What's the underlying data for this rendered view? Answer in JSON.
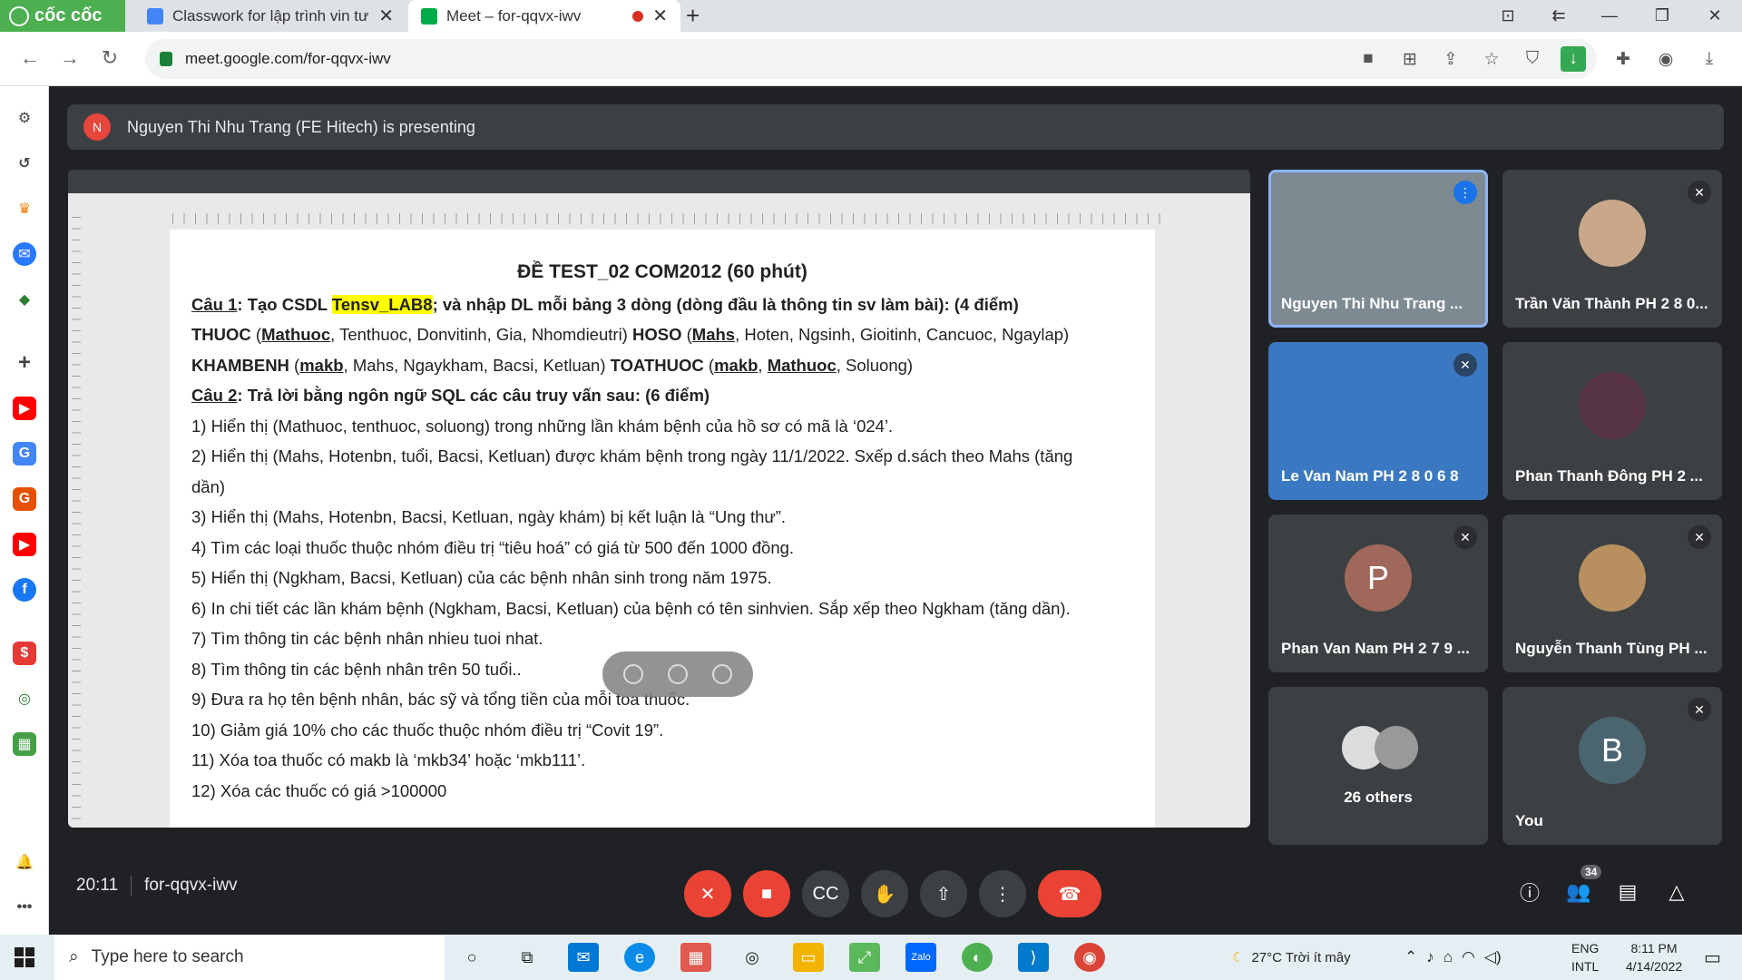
{
  "browser": {
    "brand": "cốc cốc",
    "tabs": [
      {
        "title": "Classwork for lập trình vin tư",
        "close": "✕"
      },
      {
        "title": "Meet – for-qqvx-iwv",
        "close": "✕"
      }
    ],
    "url": "meet.google.com/for-qqvx-iwv"
  },
  "banner": {
    "avatar_letter": "N",
    "text": "Nguyen Thi Nhu Trang (FE Hitech) is presenting"
  },
  "document": {
    "title": "ĐỀ TEST_02 COM2012 (60 phút)",
    "cau1_label": "Câu 1",
    "cau1_text1": ": Tạo CSDL ",
    "cau1_highlight": "Tensv_LAB8",
    "cau1_text2": "; và nhập DL mỗi bảng 3 dòng (dòng đầu là thông tin sv làm bài): (4 điểm)",
    "line2_a": "THUOC",
    "line2_b": " (",
    "line2_c": "Mathuoc",
    "line2_d": ", Tenthuoc, Donvitinh, Gia, Nhomdieutri) ",
    "line2_e": "HOSO",
    "line2_f": " (",
    "line2_g": "Mahs",
    "line2_h": ", Hoten, Ngsinh, Gioitinh, Cancuoc, Ngaylap)",
    "line3_a": "KHAMBENH",
    "line3_b": " (",
    "line3_c": "makb",
    "line3_d": ", Mahs, Ngaykham, Bacsi, Ketluan) ",
    "line3_e": "TOATHUOC",
    "line3_f": " (",
    "line3_g": "makb",
    "line3_h": ", ",
    "line3_i": "Mathuoc",
    "line3_j": ", Soluong)",
    "cau2_label": "Câu 2",
    "cau2_text": ": Trả lời bằng ngôn ngữ SQL các câu truy vấn sau: (6 điểm)",
    "questions": [
      "1) Hiển thị (Mathuoc, tenthuoc, soluong) trong những lần khám bệnh của hồ sơ có mã là ‘024’.",
      "2) Hiển thị (Mahs, Hotenbn, tuổi, Bacsi, Ketluan) được khám bệnh trong ngày 11/1/2022. Sxếp d.sách theo Mahs (tăng",
      "dần)",
      "3) Hiển thị (Mahs, Hotenbn, Bacsi, Ketluan, ngày khám) bị kết luận là “Ung thư”.",
      "4) Tìm các loại thuốc thuộc nhóm điều trị “tiêu hoá” có giá từ 500 đến 1000 đồng.",
      "5) Hiển thị (Ngkham, Bacsi, Ketluan) của  các bệnh nhân  sinh trong năm 1975.",
      "6) In chi tiết các lần khám bệnh (Ngkham, Bacsi, Ketluan) của bệnh có tên sinhvien. Sắp xếp theo Ngkham (tăng dần).",
      "7) Tìm thông tin các bệnh nhân nhieu tuoi nhat.",
      "8) Tìm thông tin các bệnh nhân trên 50 tuổi..",
      "9) Đưa ra họ tên bệnh nhân, bác sỹ và tổng tiền của mỗi toa thuốc.",
      "10) Giảm giá 10% cho các thuốc thuộc nhóm điều trị “Covit 19”.",
      "11) Xóa toa thuốc có makb là ‘mkb34’ hoặc ‘mkb111’.",
      "12) Xóa các thuốc có giá >100000"
    ]
  },
  "participants": [
    {
      "name": "Nguyen Thi Nhu Trang ...",
      "avatar": "",
      "color": "#8a9aa6"
    },
    {
      "name": "Trần Văn Thành PH 2 8 0...",
      "avatar": "",
      "color": "#c9a88a"
    },
    {
      "name": "Le Van Nam PH 2 8 0 6 8",
      "avatar": "",
      "color": "#3a78c2"
    },
    {
      "name": "Phan Thanh Đông PH 2 ...",
      "avatar": "",
      "color": "#553344"
    },
    {
      "name": "Phan Van Nam PH 2 7 9 ...",
      "avatar": "P",
      "color": "#a0685a"
    },
    {
      "name": "Nguyễn Thanh Tùng PH ...",
      "avatar": "",
      "color": "#b89060"
    },
    {
      "name": "26 others",
      "avatar": "",
      "color": "#666"
    },
    {
      "name": "You",
      "avatar": "B",
      "color": "#4a6470"
    }
  ],
  "bottom": {
    "time": "20:11",
    "meeting_code": "for-qqvx-iwv",
    "people_count": "34"
  },
  "taskbar": {
    "search_placeholder": "Type here to search",
    "weather": "27°C  Trời ít mây",
    "lang1": "ENG",
    "lang2": "INTL",
    "time": "8:11 PM",
    "date": "4/14/2022"
  }
}
